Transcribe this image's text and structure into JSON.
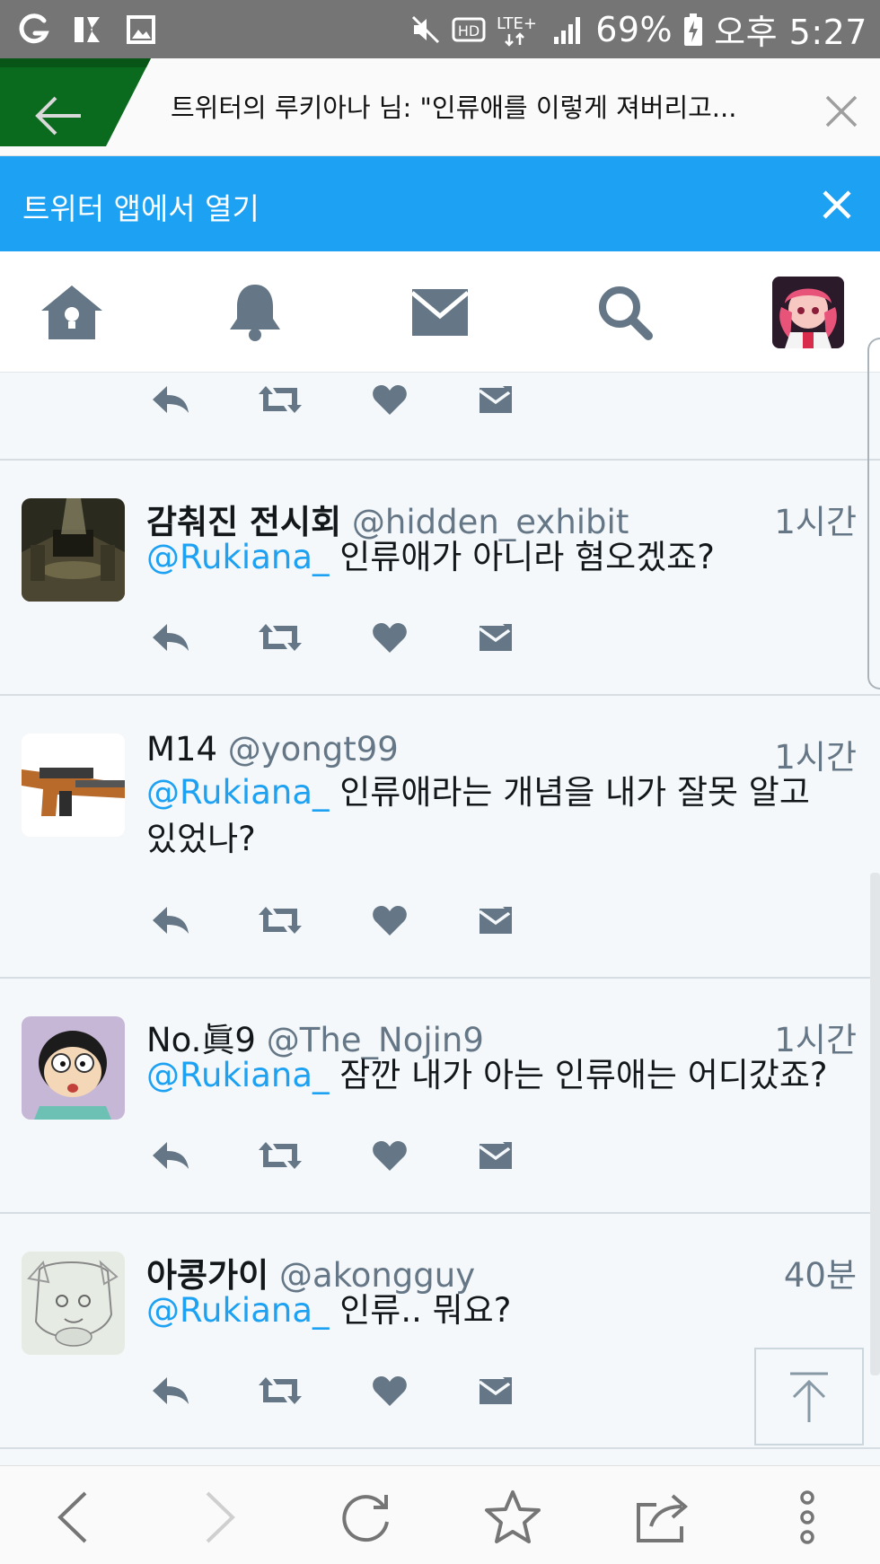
{
  "status_bar": {
    "icons_left": [
      "g-app-icon",
      "vpn-key-icon",
      "gallery-icon"
    ],
    "icons_right": [
      "mute-icon",
      "hd-icon",
      "lte-icon",
      "signal-icon"
    ],
    "battery": "69%",
    "time": "오후 5:27"
  },
  "browser": {
    "title": "트위터의 루키아나 님: \"인류애를 이렇게 져버리고...",
    "brand_color": "#0a6b1e"
  },
  "app_banner": {
    "label": "트위터 앱에서 열기",
    "color": "#1da1f2"
  },
  "nav": {
    "items": [
      "home-icon",
      "notifications-icon",
      "messages-icon",
      "search-icon",
      "profile-avatar"
    ]
  },
  "tweets": [
    {
      "name": "감춰진 전시회",
      "handle": "@hidden_exhibit",
      "time": "1시간",
      "mention": "@Rukiana_",
      "text": " 인류애가 아니라 혐오겠죠?"
    },
    {
      "name": "M14",
      "handle": "@yongt99",
      "time": "1시간",
      "mention": "@Rukiana_",
      "text": " 인류애라는 개념을 내가 잘못 알고 있었나?"
    },
    {
      "name": "No.眞9",
      "handle": "@The_Nojin9",
      "time": "1시간",
      "mention": "@Rukiana_",
      "text": " 잠깐 내가 아는 인류애는 어디갔죠?"
    },
    {
      "name": "아콩가이",
      "handle": "@akongguy",
      "time": "40분",
      "mention": "@Rukiana_",
      "text": " 인류.. 뭐요?"
    }
  ],
  "actions": [
    "reply-icon",
    "retweet-icon",
    "like-icon",
    "direct-message-icon"
  ],
  "colors": {
    "accent": "#1da1f2",
    "icon": "#657786",
    "background": "#f5f8fa"
  }
}
